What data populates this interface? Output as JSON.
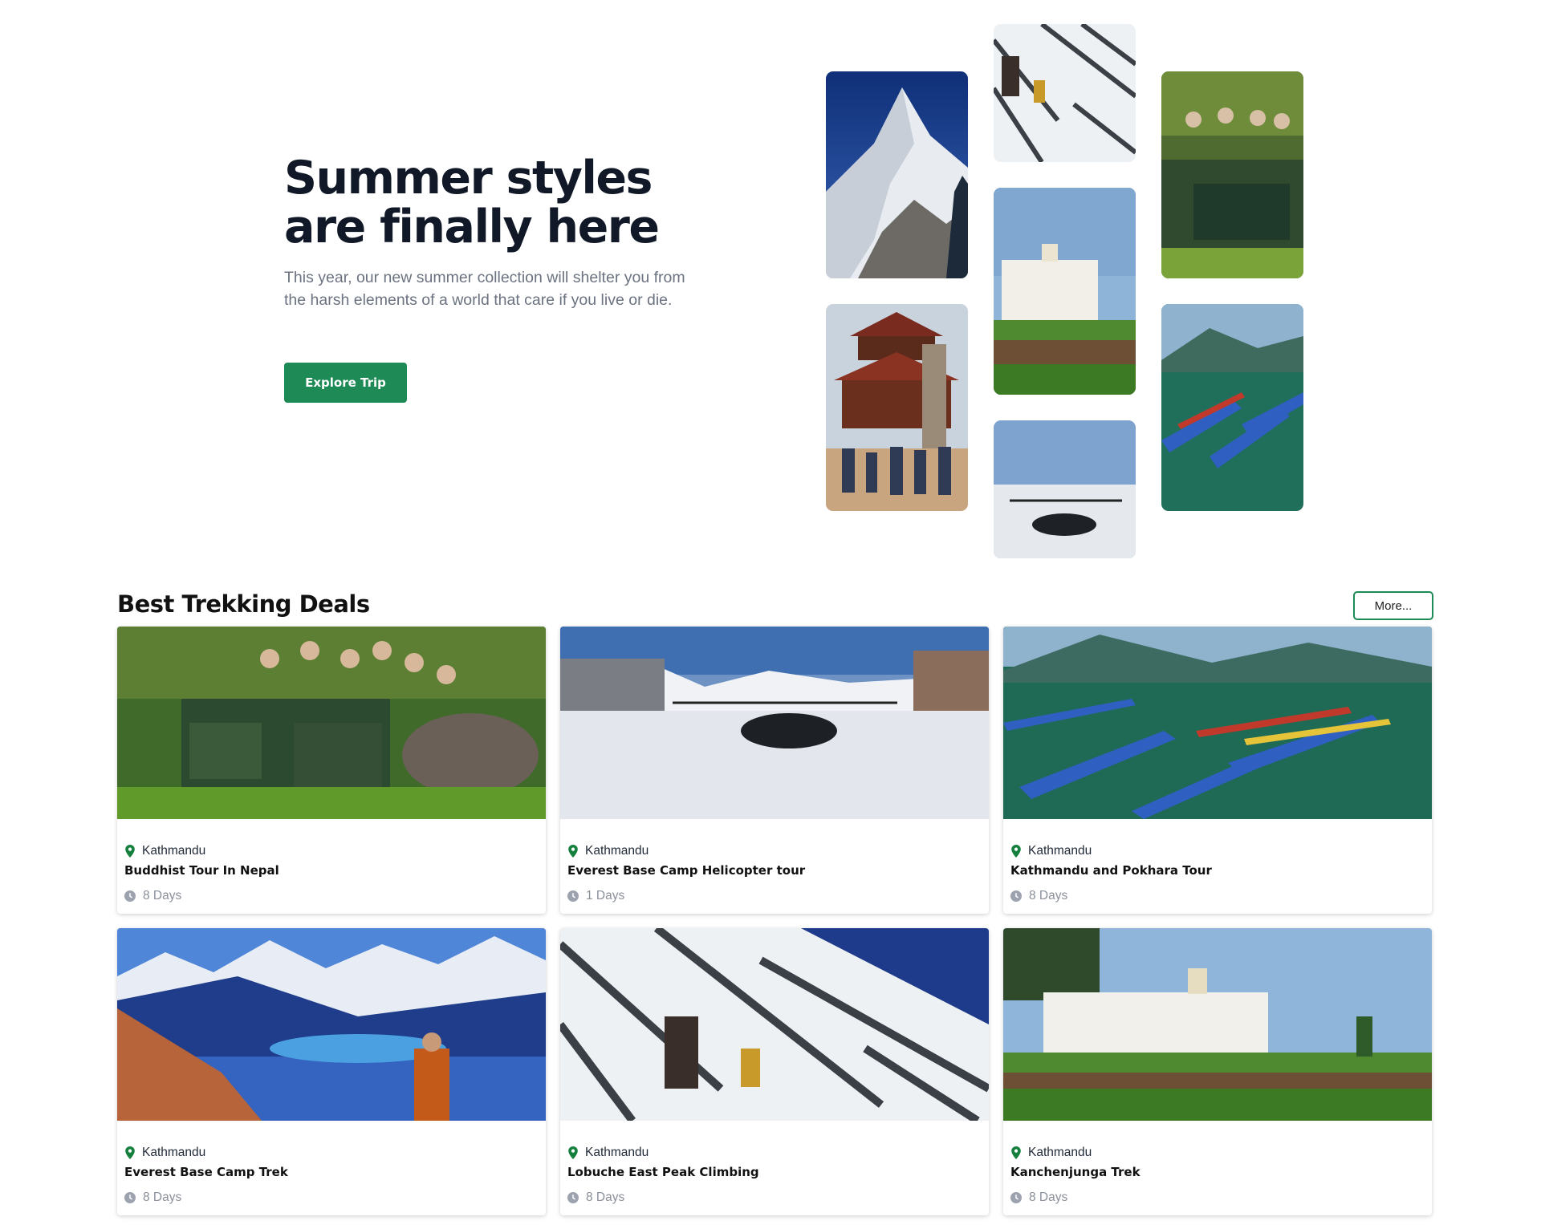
{
  "hero": {
    "title": "Summer styles are finally here",
    "description": "This year, our new summer collection will shelter you from the harsh elements of a world that care if you live or die.",
    "cta_label": "Explore Trip"
  },
  "deals": {
    "title": "Best Trekking Deals",
    "more_label": "More...",
    "cards": [
      {
        "location": "Kathmandu",
        "name": "Buddhist Tour In Nepal",
        "duration": "8 Days"
      },
      {
        "location": "Kathmandu",
        "name": "Everest Base Camp Helicopter tour",
        "duration": "1 Days"
      },
      {
        "location": "Kathmandu",
        "name": "Kathmandu and Pokhara Tour",
        "duration": "8 Days"
      },
      {
        "location": "Kathmandu",
        "name": "Everest Base Camp Trek",
        "duration": "8 Days"
      },
      {
        "location": "Kathmandu",
        "name": "Lobuche East Peak Climbing",
        "duration": "8 Days"
      },
      {
        "location": "Kathmandu",
        "name": "Kanchenjunga Trek",
        "duration": "8 Days"
      }
    ]
  },
  "icons": {
    "location": "map-pin-icon",
    "duration": "clock-icon"
  },
  "colors": {
    "accent": "#1e8a55",
    "pin": "#15803d",
    "muted": "#8a8f98"
  }
}
